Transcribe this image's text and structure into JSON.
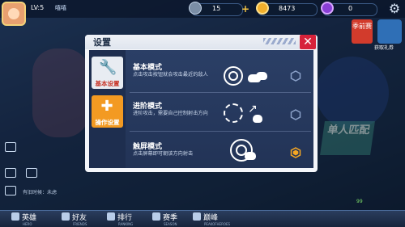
{
  "player": {
    "level": "LV:5",
    "name": "嘻嘻"
  },
  "currency": {
    "gems": "15",
    "coins": "8473",
    "orbs": "0"
  },
  "top_right": {
    "season_label": "季前赛",
    "gift_label": "获取礼券"
  },
  "dialog": {
    "title": "设置",
    "tabs": [
      {
        "label": "基本设置",
        "icon": "wrench-icon"
      },
      {
        "label": "操作设置",
        "icon": "plus-icon"
      }
    ],
    "modes": [
      {
        "title": "基本模式",
        "desc": "点击攻击按钮就会攻击最近的敌人",
        "selected": false
      },
      {
        "title": "进阶模式",
        "desc": "进阶攻击，需要自己控制射击方向",
        "selected": false
      },
      {
        "title": "触屏模式",
        "desc": "点击屏幕即可朝该方向射击",
        "selected": true
      }
    ],
    "colors": {
      "selected": "#f5a623",
      "unselected": "#8aa0c8",
      "close": "#d7223a",
      "active_tab": "#f39a22"
    }
  },
  "background": {
    "single_match": "单人匹配"
  },
  "chat": {
    "line": "有旧时候：未虑"
  },
  "status": {
    "battery": "99"
  },
  "nav": [
    {
      "label": "英雄",
      "sub": "HERO"
    },
    {
      "label": "好友",
      "sub": "FRIENDS"
    },
    {
      "label": "排行",
      "sub": "RANKING"
    },
    {
      "label": "赛季",
      "sub": "SEASON"
    },
    {
      "label": "巅峰",
      "sub": "PEAKOFHEROES"
    }
  ]
}
